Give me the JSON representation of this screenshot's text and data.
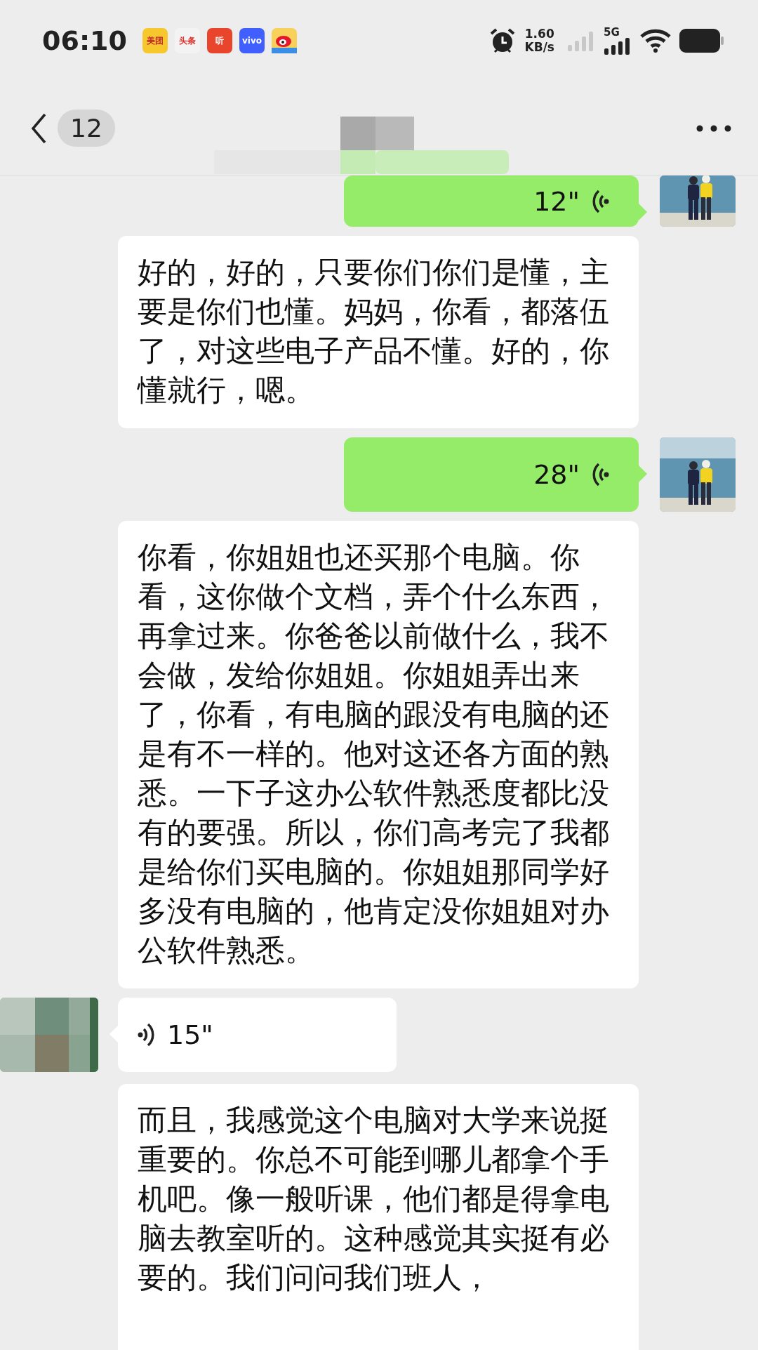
{
  "status_bar": {
    "time": "06:10",
    "app_icons": [
      {
        "kind": "label",
        "label": "美团",
        "color": "#f7c82e"
      },
      {
        "kind": "label",
        "label": "头条",
        "color": "#f3f3f3"
      },
      {
        "kind": "label",
        "label": "听",
        "color": "#e8452c"
      },
      {
        "kind": "label",
        "label": "vivo",
        "color": "#415fff"
      },
      {
        "kind": "logo",
        "color": "#f8d15a"
      }
    ],
    "network_speed": "1.60",
    "network_unit": "KB/s",
    "network_type": "5G"
  },
  "header": {
    "back_count": "12"
  },
  "messages": [
    {
      "kind": "voice",
      "outgoing": true,
      "show_avatar": true,
      "duration": "12\""
    },
    {
      "kind": "text",
      "outgoing": false,
      "show_avatar": false,
      "text": "好的，好的，只要你们你们是懂，主要是你们也懂。妈妈，你看，都落伍了，对这些电子产品不懂。好的，你懂就行，嗯。"
    },
    {
      "kind": "voice",
      "outgoing": true,
      "show_avatar": true,
      "duration": "28\""
    },
    {
      "kind": "text",
      "outgoing": false,
      "show_avatar": false,
      "text": "你看，你姐姐也还买那个电脑。你看，这你做个文档，弄个什么东西，再拿过来。你爸爸以前做什么，我不会做，发给你姐姐。你姐姐弄出来了，你看，有电脑的跟没有电脑的还是有不一样的。他对这还各方面的熟悉。一下子这办公软件熟悉度都比没有的要强。所以，你们高考完了我都是给你们买电脑的。你姐姐那同学好多没有电脑的，他肯定没你姐姐对办公软件熟悉。"
    },
    {
      "kind": "voice",
      "outgoing": false,
      "show_avatar": true,
      "duration": "15\""
    },
    {
      "kind": "text",
      "outgoing": false,
      "show_avatar": false,
      "text": "而且，我感觉这个电脑对大学来说挺重要的。你总不可能到哪儿都拿个手机吧。像一般听课，他们都是得拿电脑去教室听的。这种感觉其实挺有必要的。我们问问我们班人，"
    }
  ]
}
